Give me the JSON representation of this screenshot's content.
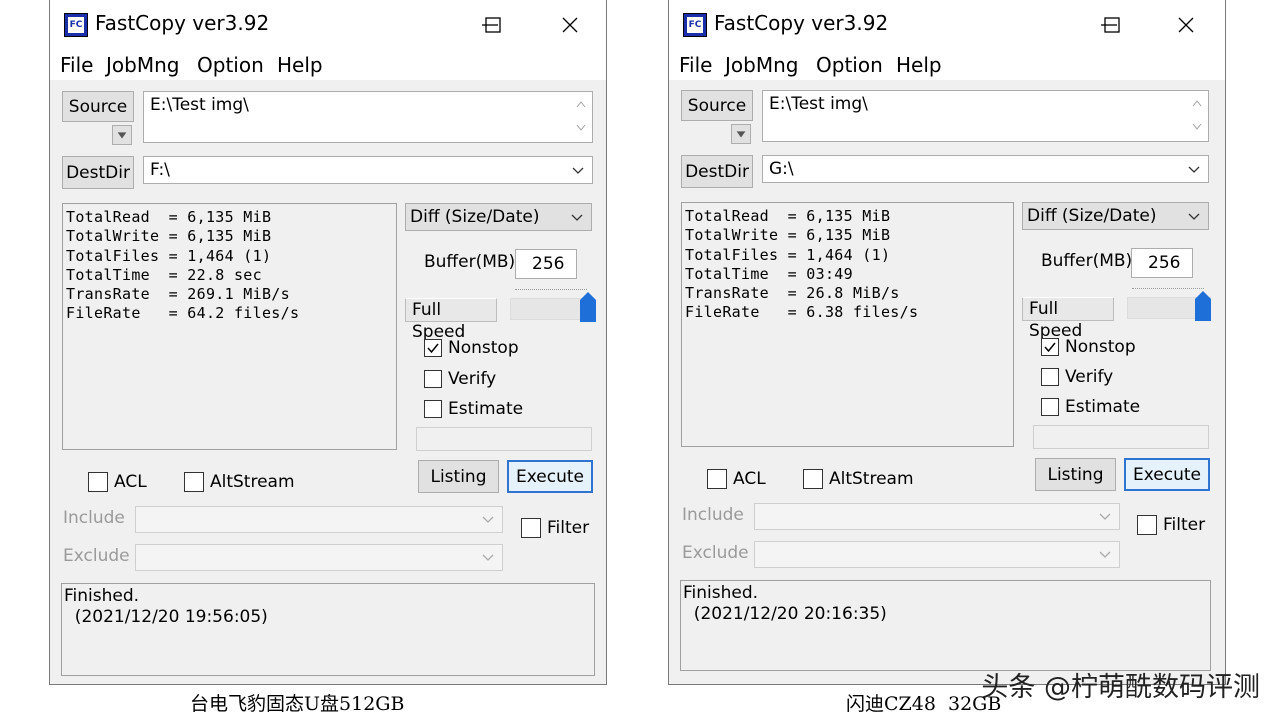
{
  "windows": [
    {
      "title": "FastCopy ver3.92",
      "menu": [
        "File",
        "JobMng",
        "Option",
        "Help"
      ],
      "source_label": "Source",
      "source_value": "E:\\Test img\\",
      "destdir_label": "DestDir",
      "destdir_value": "F:\\",
      "stats": [
        "TotalRead  = 6,135 MiB",
        "TotalWrite = 6,135 MiB",
        "TotalFiles = 1,464 (1)",
        "TotalTime  = 22.8 sec",
        "TransRate  = 269.1 MiB/s",
        "FileRate   = 64.2 files/s"
      ],
      "mode": "Diff (Size/Date)",
      "buffer_label": "Buffer(MB)",
      "buffer_value": "256",
      "speed_label": "Full Speed",
      "speed_level": 1.0,
      "nonstop_label": "Nonstop",
      "nonstop_checked": true,
      "verify_label": "Verify",
      "verify_checked": false,
      "estimate_label": "Estimate",
      "estimate_checked": false,
      "acl_label": "ACL",
      "altstream_label": "AltStream",
      "listing_label": "Listing",
      "execute_label": "Execute",
      "include_label": "Include",
      "exclude_label": "Exclude",
      "filter_label": "Filter",
      "log_line1": "Finished.",
      "log_line2": "  (2021/12/20 19:56:05)"
    },
    {
      "title": "FastCopy ver3.92",
      "menu": [
        "File",
        "JobMng",
        "Option",
        "Help"
      ],
      "source_label": "Source",
      "source_value": "E:\\Test img\\",
      "destdir_label": "DestDir",
      "destdir_value": "G:\\",
      "stats": [
        "TotalRead  = 6,135 MiB",
        "TotalWrite = 6,135 MiB",
        "TotalFiles = 1,464 (1)",
        "TotalTime  = 03:49",
        "TransRate  = 26.8 MiB/s",
        "FileRate   = 6.38 files/s"
      ],
      "mode": "Diff (Size/Date)",
      "buffer_label": "Buffer(MB)",
      "buffer_value": "256",
      "speed_label": "Full Speed",
      "speed_level": 1.0,
      "nonstop_label": "Nonstop",
      "nonstop_checked": true,
      "verify_label": "Verify",
      "verify_checked": false,
      "estimate_label": "Estimate",
      "estimate_checked": false,
      "acl_label": "ACL",
      "altstream_label": "AltStream",
      "listing_label": "Listing",
      "execute_label": "Execute",
      "include_label": "Include",
      "exclude_label": "Exclude",
      "filter_label": "Filter",
      "log_line1": "Finished.",
      "log_line2": "  (2021/12/20 20:16:35)"
    }
  ],
  "captions": [
    "台电飞豹固态U盘512GB",
    "闪迪CZ48  32GB"
  ],
  "watermark": "头条 @柠萌酰数码评测",
  "colors": {
    "accent": "#2f74d0",
    "thumb": "#1f6fd8",
    "window_bg": "#f0f0f0"
  },
  "icons": [
    "app-icon",
    "minimize-icon",
    "maximize-icon",
    "close-icon",
    "chevron-down-icon",
    "check-icon"
  ]
}
